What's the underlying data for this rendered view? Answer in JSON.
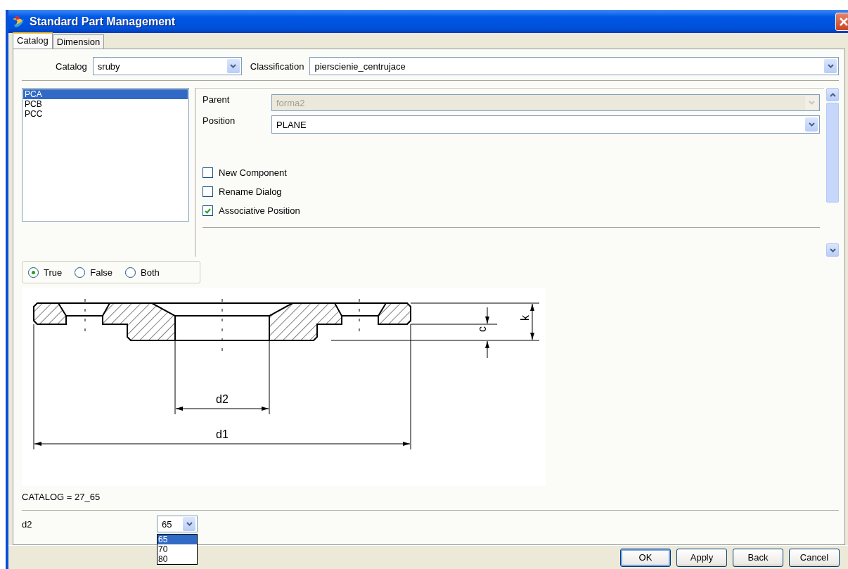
{
  "window": {
    "title": "Standard Part Management"
  },
  "tabs": [
    {
      "label": "Catalog",
      "selected": true
    },
    {
      "label": "Dimension",
      "selected": false
    }
  ],
  "catalog": {
    "label": "Catalog",
    "value": "sruby"
  },
  "classification": {
    "label": "Classification",
    "value": "pierscienie_centrujace"
  },
  "parts": [
    {
      "label": "PCA",
      "selected": true
    },
    {
      "label": "PCB",
      "selected": false
    },
    {
      "label": "PCC",
      "selected": false
    }
  ],
  "properties": [
    {
      "label": "Parent",
      "value": "forma2",
      "disabled": true
    },
    {
      "label": "Position",
      "value": "PLANE",
      "disabled": false
    }
  ],
  "options": [
    {
      "label": "New Component",
      "checked": false
    },
    {
      "label": "Rename Dialog",
      "checked": false
    },
    {
      "label": "Associative Position",
      "checked": true
    }
  ],
  "filter": [
    {
      "label": "True",
      "selected": true
    },
    {
      "label": "False",
      "selected": false
    },
    {
      "label": "Both",
      "selected": false
    }
  ],
  "drawing": {
    "dimension_labels": [
      {
        "text": "d2"
      },
      {
        "text": "d1"
      },
      {
        "text": "c"
      },
      {
        "text": "k"
      }
    ]
  },
  "catalog_line": "CATALOG = 27_65",
  "dimension": {
    "label": "d2",
    "value": "65",
    "options": [
      {
        "label": "65",
        "selected": true
      },
      {
        "label": "70",
        "selected": false
      },
      {
        "label": "80",
        "selected": false
      }
    ]
  },
  "buttons": [
    {
      "label": "OK",
      "default": true
    },
    {
      "label": "Apply",
      "default": false
    },
    {
      "label": "Back",
      "default": false
    },
    {
      "label": "Cancel",
      "default": false
    }
  ]
}
